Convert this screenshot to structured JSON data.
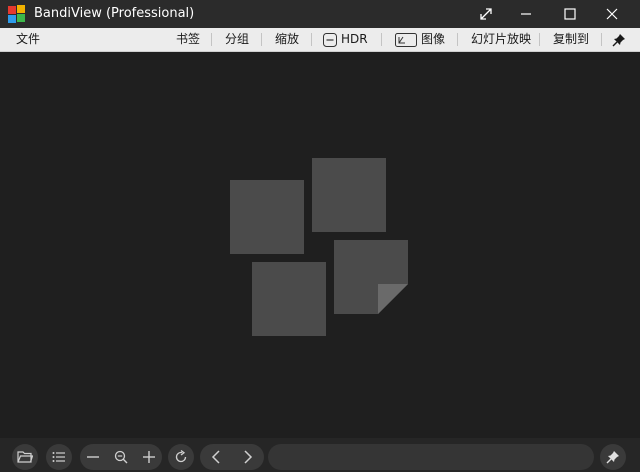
{
  "window": {
    "title": "BandiView (Professional)",
    "controls": [
      "fullscreen-icon",
      "minimize-icon",
      "maximize-icon",
      "close-icon"
    ]
  },
  "menu": {
    "file": "文件",
    "bookmark": "书签",
    "group": "分组",
    "zoom": "缩放",
    "hdr": "HDR",
    "image": "图像",
    "slideshow": "幻灯片放映",
    "copy_to": "复制到",
    "pin_icon": "pin-icon"
  },
  "viewer": {
    "placeholder_icon": "images-placeholder-icon"
  },
  "toolbar": {
    "buttons": [
      "folder-open-icon",
      "list-icon",
      "zoom-out-icon",
      "zoom-fit-icon",
      "zoom-in-icon",
      "rotate-icon",
      "previous-icon",
      "next-icon",
      "pin-icon"
    ],
    "path_value": ""
  },
  "colors": {
    "title_bar": "#2b2b2b",
    "menu_bar": "#ececec",
    "viewer_bg": "#1f1f1f",
    "placeholder_tile": "#4b4b4b",
    "logo": [
      "#e5392f",
      "#f2b200",
      "#2e9bea",
      "#3db84a"
    ]
  }
}
